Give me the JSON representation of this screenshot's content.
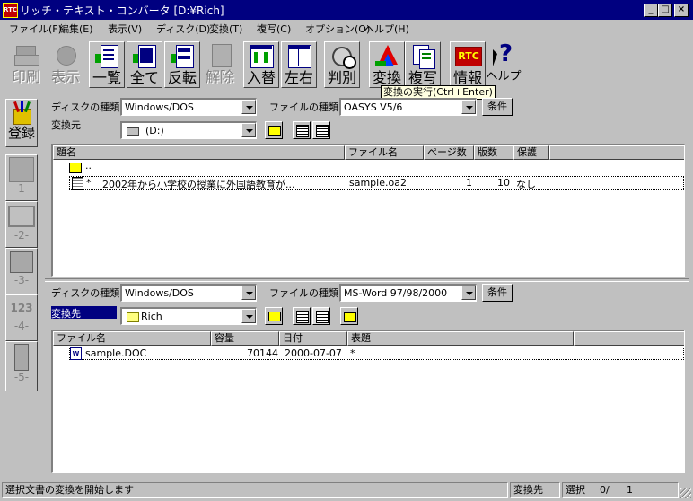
{
  "window": {
    "title": "リッチ・テキスト・コンバータ [D:¥Rich]",
    "app_icon_text": "RTC",
    "controls": {
      "minimize": "_",
      "maximize": "□",
      "close": "×"
    }
  },
  "menubar": {
    "items": [
      {
        "label": "ファイル(F)"
      },
      {
        "label": "編集(E)"
      },
      {
        "label": "表示(V)"
      },
      {
        "label": "ディスク(D)"
      },
      {
        "label": "変換(T)"
      },
      {
        "label": "複写(C)"
      },
      {
        "label": "オプション(O)"
      },
      {
        "label": "ヘルプ(H)"
      }
    ]
  },
  "toolbar": {
    "buttons": [
      {
        "label": "印刷",
        "enabled": false,
        "icon": "printer-icon"
      },
      {
        "label": "表示",
        "enabled": false,
        "icon": "view-icon"
      },
      {
        "label": "一覧",
        "enabled": true,
        "icon": "list-icon"
      },
      {
        "label": "全て",
        "enabled": true,
        "icon": "select-all-icon"
      },
      {
        "label": "反転",
        "enabled": true,
        "icon": "invert-icon"
      },
      {
        "label": "解除",
        "enabled": false,
        "icon": "deselect-icon"
      },
      {
        "label": "入替",
        "enabled": true,
        "icon": "swap-icon"
      },
      {
        "label": "左右",
        "enabled": true,
        "icon": "left-right-icon"
      },
      {
        "label": "判別",
        "enabled": true,
        "icon": "identify-icon"
      },
      {
        "label": "変換",
        "enabled": true,
        "icon": "convert-icon"
      },
      {
        "label": "複写",
        "enabled": true,
        "icon": "copy-icon"
      },
      {
        "label": "情報",
        "enabled": true,
        "icon": "rtc-info-icon"
      },
      {
        "label": "ヘルプ",
        "enabled": true,
        "icon": "help-icon"
      }
    ],
    "tooltip": "変換の実行(Ctrl+Enter)"
  },
  "left_panel": {
    "register_label": "登録",
    "slots": [
      "-1-",
      "-2-",
      "-3-",
      "-4-",
      "-5-"
    ],
    "slot4_icon_text": "123"
  },
  "source": {
    "disk_type_label": "ディスクの種類",
    "disk_type_value": "Windows/DOS",
    "file_type_label": "ファイルの種類",
    "file_type_value": "OASYS V5/6",
    "condition_button": "条件",
    "location_label": "変換元",
    "location_value": "(D:)",
    "columns": [
      "題名",
      "ファイル名",
      "ページ数",
      "版数",
      "保護"
    ],
    "parent_row": "..",
    "rows": [
      {
        "mark": "*",
        "title": "2002年から小学校の授業に外国語教育が...",
        "filename": "sample.oa2",
        "pages": "1",
        "version": "10",
        "protect": "なし"
      }
    ]
  },
  "dest": {
    "disk_type_label": "ディスクの種類",
    "disk_type_value": "Windows/DOS",
    "file_type_label": "ファイルの種類",
    "file_type_value": "MS-Word 97/98/2000",
    "condition_button": "条件",
    "location_label": "変換先",
    "location_value": "Rich",
    "columns": [
      "ファイル名",
      "容量",
      "日付",
      "表題"
    ],
    "rows": [
      {
        "filename": "sample.DOC",
        "size": "70144",
        "date": "2000-07-07",
        "title": "*"
      }
    ]
  },
  "statusbar": {
    "message": "選択文書の変換を開始します",
    "target": "変換先",
    "selection_label": "選択",
    "selection_value": "0/",
    "total": "1"
  },
  "colors": {
    "title_bar": "#000080",
    "window_bg": "#c0c0c0",
    "selection": "#000080",
    "tooltip_bg": "#ffffe1"
  }
}
